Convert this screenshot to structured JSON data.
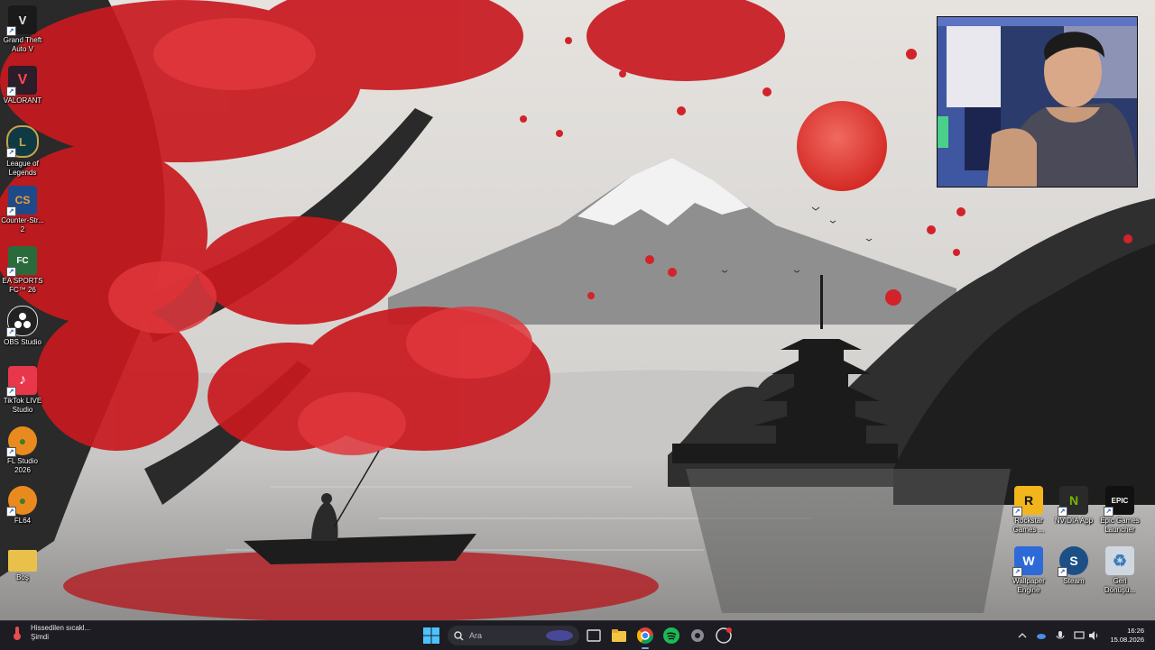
{
  "desktop_left_icons": [
    {
      "label": "Grand Theft Auto V",
      "icon": "gta-v-icon",
      "color": "#1a1a1a"
    },
    {
      "label": "VALORANT",
      "icon": "valorant-icon",
      "color": "#2b1d2a"
    },
    {
      "label": "League of Legends",
      "icon": "league-of-legends-icon",
      "color": "#0f3a44"
    },
    {
      "label": "Counter-Str... 2",
      "icon": "counter-strike-icon",
      "color": "#1f4a8a"
    },
    {
      "label": "EA SPORTS FC™ 26",
      "icon": "ea-sports-fc-icon",
      "color": "#2a6b3c"
    },
    {
      "label": "OBS Studio",
      "icon": "obs-studio-icon",
      "color": "#222222"
    },
    {
      "label": "TikTok LIVE Studio",
      "icon": "tiktok-live-icon",
      "color": "#e8374b"
    },
    {
      "label": "FL Studio 2026",
      "icon": "fl-studio-icon",
      "color": "#e98a1f"
    },
    {
      "label": "FL64",
      "icon": "fl64-icon",
      "color": "#e98a1f"
    },
    {
      "label": "Boş",
      "icon": "folder-icon",
      "color": "#e9c04a"
    }
  ],
  "desktop_right_icons": [
    {
      "label": "Rockstar Games ...",
      "icon": "rockstar-games-icon",
      "color": "#f2b51c",
      "glyph": "R"
    },
    {
      "label": "NVIDIA App",
      "icon": "nvidia-app-icon",
      "color": "#2a2a2a",
      "glyph": "N"
    },
    {
      "label": "Epic Games Launcher",
      "icon": "epic-games-icon",
      "color": "#111111",
      "glyph": "EPIC"
    },
    {
      "label": "Wallpaper Engine",
      "icon": "wallpaper-engine-icon",
      "color": "#2d6ad8",
      "glyph": "W"
    },
    {
      "label": "Steam",
      "icon": "steam-icon",
      "color": "#1b4f86",
      "glyph": "S"
    },
    {
      "label": "Geri Dönüşü...",
      "icon": "recycle-bin-icon",
      "color": "#cfd8e0",
      "glyph": "♻"
    }
  ],
  "taskbar": {
    "weather_text": "Hissedilen sıcakl...",
    "weather_subtext": "Şimdi",
    "search_placeholder": "Ara",
    "clock_time": "16:26",
    "clock_date": "15.08.2026",
    "pinned_apps": [
      "file-explorer-icon",
      "chrome-icon",
      "spotify-icon",
      "settings-icon",
      "app-icon"
    ]
  },
  "colors": {
    "taskbar_bg": "#1c1c22",
    "accent_red": "#d8262b",
    "sun": "#e2413a"
  }
}
